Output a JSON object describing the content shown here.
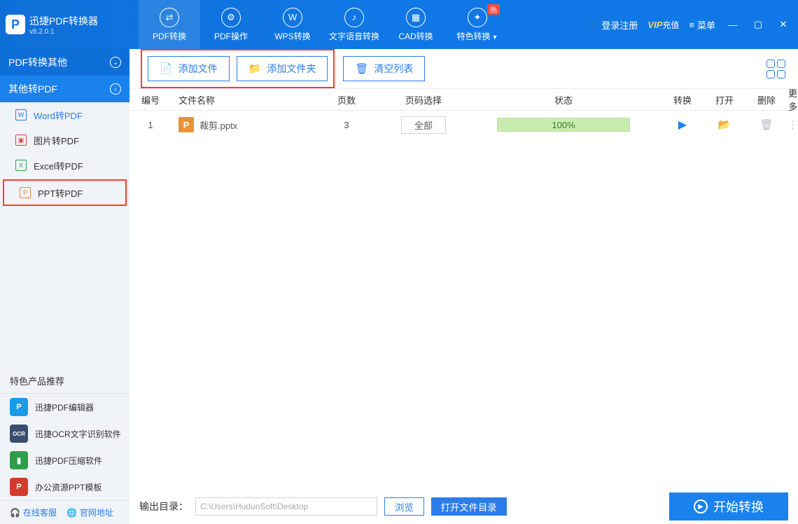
{
  "app": {
    "title": "迅捷PDF转换器",
    "version": "v8.2.0.1"
  },
  "tabs": [
    {
      "label": "PDF转换",
      "icon": "⇄",
      "active": true
    },
    {
      "label": "PDF操作",
      "icon": "⚙"
    },
    {
      "label": "WPS转换",
      "icon": "W"
    },
    {
      "label": "文字语音转换",
      "icon": "♪"
    },
    {
      "label": "CAD转换",
      "icon": "▦"
    },
    {
      "label": "特色转换",
      "icon": "✦",
      "dropdown": true,
      "badge": "热"
    }
  ],
  "header_right": {
    "login": "登录注册",
    "vip": "VIP",
    "vip_suffix": "充值",
    "menu": "菜单"
  },
  "sidebar": {
    "section1": {
      "title": "PDF转换其他"
    },
    "section2": {
      "title": "其他转PDF",
      "items": [
        {
          "label": "Word转PDF",
          "cls": "word",
          "fi": "W"
        },
        {
          "label": "图片转PDF",
          "cls": "img",
          "fi": "▣"
        },
        {
          "label": "Excel转PDF",
          "cls": "xls",
          "fi": "X"
        },
        {
          "label": "PPT转PDF",
          "cls": "ppt",
          "fi": "P",
          "selected": true
        }
      ]
    },
    "recommend_title": "特色产品推荐",
    "products": [
      {
        "label": "迅捷PDF编辑器",
        "color": "#1a9ae8",
        "fi": "P"
      },
      {
        "label": "迅捷OCR文字识别软件",
        "color": "#3a4d6e",
        "fi": "OCR"
      },
      {
        "label": "迅捷PDF压缩软件",
        "color": "#2e9e4a",
        "fi": "▮"
      },
      {
        "label": "办公资源PPT模板",
        "color": "#d33b2f",
        "fi": "P"
      }
    ],
    "bottom": {
      "kefu": "在线客服",
      "site": "官网地址"
    }
  },
  "toolbar": {
    "add_file": "添加文件",
    "add_folder": "添加文件夹",
    "clear": "清空列表"
  },
  "columns": {
    "num": "编号",
    "name": "文件名称",
    "pages": "页数",
    "sel": "页码选择",
    "state": "状态",
    "conv": "转换",
    "open": "打开",
    "del": "删除",
    "more": "更多"
  },
  "rows": [
    {
      "num": "1",
      "name": "裁剪.pptx",
      "icon": "P",
      "pages": "3",
      "sel": "全部",
      "progress": "100%"
    }
  ],
  "footer": {
    "out_label": "输出目录：",
    "path": "C:\\Users\\HudunSoft\\Desktop",
    "browse": "浏览",
    "open_dir": "打开文件目录",
    "start": "开始转换"
  }
}
